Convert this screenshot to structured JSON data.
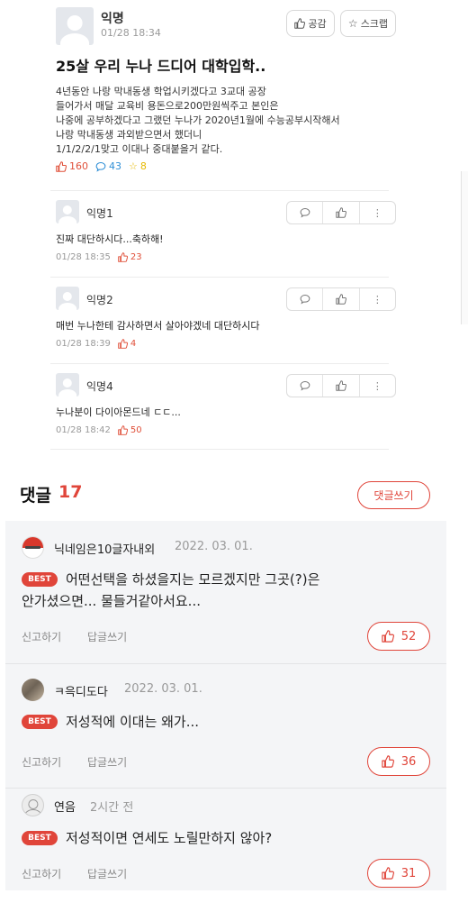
{
  "post": {
    "author": "익명",
    "time": "01/28 18:34",
    "like_label": "공감",
    "scrap_label": "스크랩",
    "title": "25살 우리 누나 드디어 대학입학..",
    "body_lines": [
      "4년동안 나랑 막내동생 학업시키겠다고 3교대 공장",
      "들어가서 매달 교육비 용돈으로200만원씩주고 본인은",
      "나중에 공부하겠다고 그랬던 누나가 2020년1월에 수능공부시작해서",
      "나랑 막내동생 과외받으면서 했더니",
      "1/1/2/2/1맞고 이대나 중대붙을거 같다."
    ],
    "likes": "160",
    "comments": "43",
    "scraps": "8"
  },
  "replies": [
    {
      "author": "익명1",
      "text": "진짜 대단하시다...축하해!",
      "time": "01/28 18:35",
      "likes": "23"
    },
    {
      "author": "익명2",
      "text": "매번 누나한테 감사하면서 살아야겠네 대단하시다",
      "time": "01/28 18:39",
      "likes": "4"
    },
    {
      "author": "익명4",
      "text": "누나분이 다이아몬드네 ㄷㄷ...",
      "time": "01/28 18:42",
      "likes": "50"
    }
  ],
  "comments_section": {
    "title": "댓글",
    "count": "17",
    "write_label": "댓글쓰기",
    "report_label": "신고하기",
    "reply_label": "답글쓰기",
    "best_label": "BEST",
    "items": [
      {
        "author": "닉네임은10글자내외",
        "date": "2022. 03. 01.",
        "lines": [
          "어떤선택을 하셨을지는 모르겠지만 그곳(?)은",
          "안가셨으면... 물들거같아서요..."
        ],
        "likes": "52"
      },
      {
        "author": "ㅋ윽디도다",
        "date": "2022. 03. 01.",
        "lines": [
          "저성적에 이대는 왜가..."
        ],
        "likes": "36"
      },
      {
        "author": "연음",
        "date": "2시간 전",
        "lines": [
          "저성적이면 연세도 노릴만하지 않아?"
        ],
        "likes": "31"
      }
    ]
  },
  "colors": {
    "accent": "#e0453a",
    "comment_blue": "#2f8fd6",
    "star_yellow": "#e6b800",
    "comment_bg": "#f4f5f7"
  },
  "icons": [
    "thumbs-up-icon",
    "star-icon",
    "speech-bubble-icon",
    "more-dots-icon",
    "avatar-icon"
  ]
}
